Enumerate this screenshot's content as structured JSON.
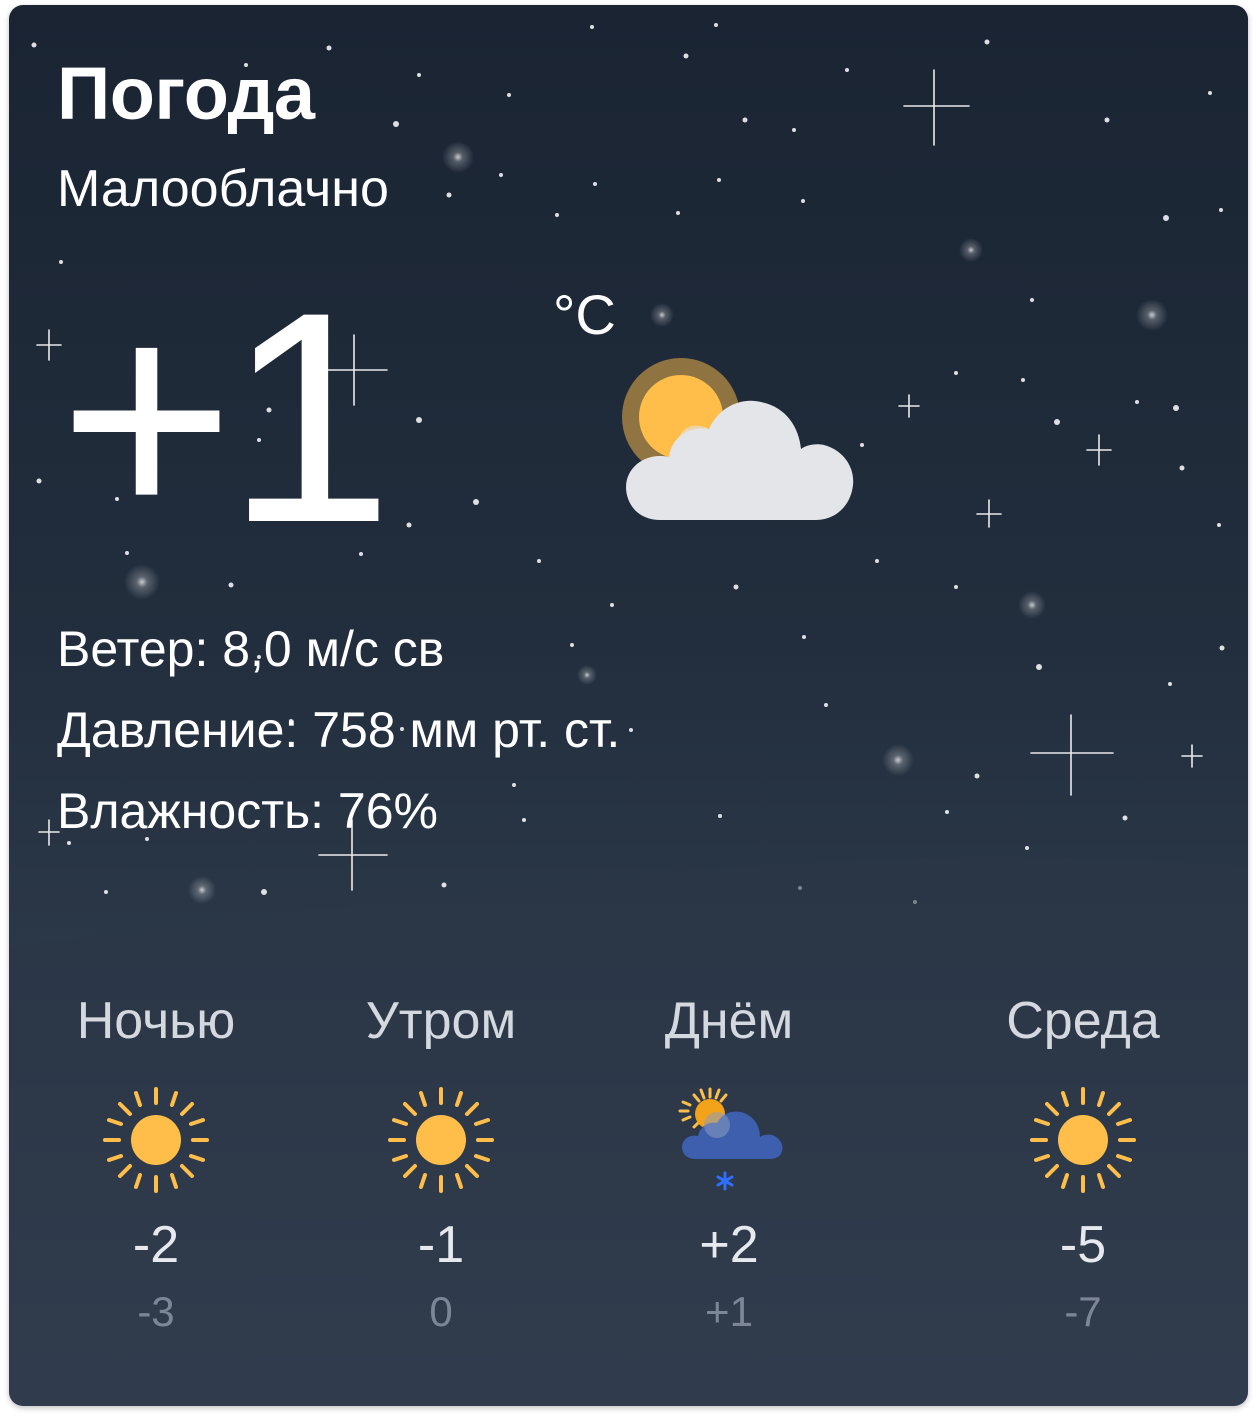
{
  "widget": {
    "title": "Погода",
    "condition": "Малооблачно",
    "temperature": "+1",
    "unit": "°C",
    "main_icon": "partly-cloudy-day-icon"
  },
  "details": {
    "wind": "Ветер: 8,0 м/с св",
    "pressure": "Давление: 758 мм рт. ст.",
    "humidity": "Влажность: 76%"
  },
  "forecast": [
    {
      "label": "Ночью",
      "icon": "sun-icon",
      "high": "-2",
      "low": "-3"
    },
    {
      "label": "Утром",
      "icon": "sun-icon",
      "high": "-1",
      "low": "0"
    },
    {
      "label": "Днём",
      "icon": "partly-cloudy-snow-icon",
      "high": "+2",
      "low": "+1"
    },
    {
      "label": "Среда",
      "icon": "sun-icon",
      "high": "-5",
      "low": "-7"
    }
  ],
  "colors": {
    "background_top": "#1a2433",
    "background_bottom": "#374455",
    "sun": "#ffbe4a",
    "cloud": "#e3e5e8",
    "snow_cloud": "#3d5fae",
    "snowflake": "#2f6fff",
    "low_temp": "#7c8696"
  }
}
